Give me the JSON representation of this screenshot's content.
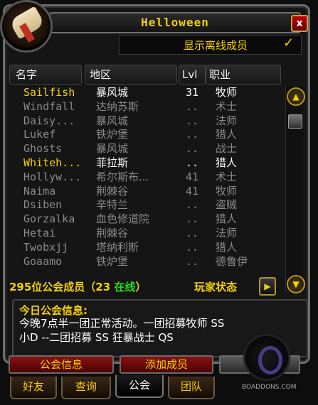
{
  "window": {
    "title": "Helloween",
    "close_label": "x"
  },
  "show_offline": {
    "label": "显示离线成员",
    "checked_mark": "✓"
  },
  "columns": {
    "name": "名字",
    "zone": "地区",
    "level": "Lvl",
    "class": "职业"
  },
  "members": [
    {
      "name": "Sailfish",
      "zone": "暴风城",
      "level": "31",
      "class": "牧师",
      "color": "#f5d100",
      "zone_color": "#ffffff"
    },
    {
      "name": "Windfall",
      "zone": "达纳苏斯",
      "level": "..",
      "class": "术士",
      "color": "#8a8a8a",
      "zone_color": "#8a8a8a"
    },
    {
      "name": "Daisy...",
      "zone": "暴风城",
      "level": "..",
      "class": "法师",
      "color": "#8a8a8a",
      "zone_color": "#8a8a8a"
    },
    {
      "name": "Lukef",
      "zone": "铁炉堡",
      "level": "..",
      "class": "猎人",
      "color": "#8a8a8a",
      "zone_color": "#8a8a8a"
    },
    {
      "name": "Ghosts",
      "zone": "暴风城",
      "level": "..",
      "class": "战士",
      "color": "#8a8a8a",
      "zone_color": "#8a8a8a"
    },
    {
      "name": "Whiteh...",
      "zone": "菲拉斯",
      "level": "..",
      "class": "猎人",
      "color": "#f5d100",
      "zone_color": "#ffffff"
    },
    {
      "name": "Hollyw...",
      "zone": "希尔斯布...",
      "level": "41",
      "class": "术士",
      "color": "#8a8a8a",
      "zone_color": "#8a8a8a"
    },
    {
      "name": "Naima",
      "zone": "荆棘谷",
      "level": "41",
      "class": "牧师",
      "color": "#8a8a8a",
      "zone_color": "#8a8a8a"
    },
    {
      "name": "Dsiben",
      "zone": "辛特兰",
      "level": "..",
      "class": "盗贼",
      "color": "#8a8a8a",
      "zone_color": "#8a8a8a"
    },
    {
      "name": "Gorzalka",
      "zone": "血色修道院",
      "level": "..",
      "class": "猎人",
      "color": "#8a8a8a",
      "zone_color": "#8a8a8a"
    },
    {
      "name": "Hetai",
      "zone": "荆棘谷",
      "level": "..",
      "class": "法师",
      "color": "#8a8a8a",
      "zone_color": "#8a8a8a"
    },
    {
      "name": "Twobxjj",
      "zone": "塔纳利斯",
      "level": "..",
      "class": "猎人",
      "color": "#8a8a8a",
      "zone_color": "#8a8a8a"
    },
    {
      "name": "Goaamo",
      "zone": "铁炉堡",
      "level": "..",
      "class": "德鲁伊",
      "color": "#8a8a8a",
      "zone_color": "#8a8a8a"
    }
  ],
  "summary": {
    "count_text": "295位公会成员（23 ",
    "online_text": "在线",
    "close_paren": "）"
  },
  "player_status": {
    "label": "玩家状态",
    "arrow": "▶"
  },
  "motd": {
    "title": "今日公会信息:",
    "text": "今晚7点半一团正常活动。一团招募牧师 SS\n小D --二团招募 SS 狂暴战士 QS"
  },
  "buttons": {
    "guild_info": "公会信息",
    "add_member": "添加成员",
    "control": "公会"
  },
  "tabs": [
    "好友",
    "查询",
    "公会",
    "团队"
  ],
  "watermark": {
    "text": "BOADDONS.COM"
  }
}
